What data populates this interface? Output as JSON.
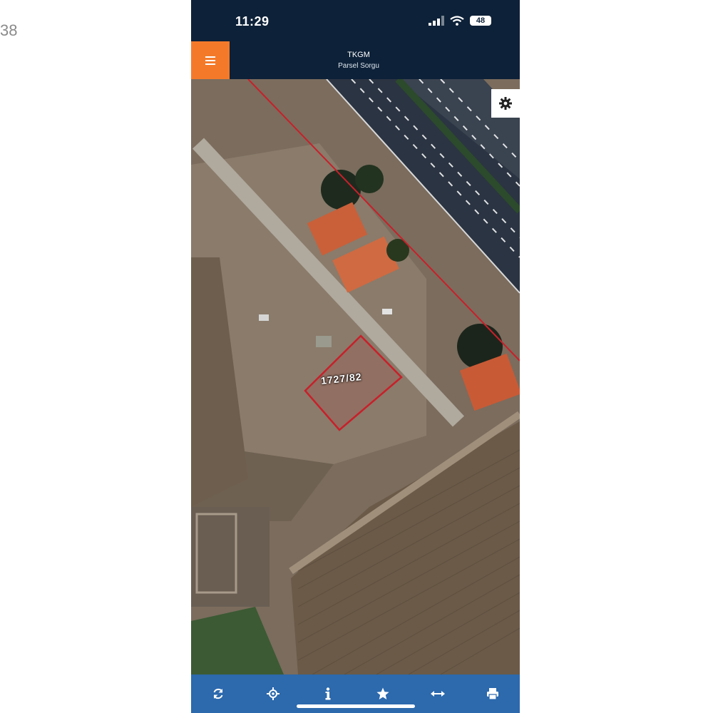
{
  "edge": {
    "left_text": "38"
  },
  "status_bar": {
    "time": "11:29",
    "battery": "48"
  },
  "header": {
    "title": "TKGM",
    "subtitle": "Parsel Sorgu"
  },
  "map": {
    "parcel_label": "1727/82",
    "icons": [
      "gear-icon"
    ]
  },
  "toolbar": {
    "items": [
      {
        "icon": "refresh-icon"
      },
      {
        "icon": "locate-icon"
      },
      {
        "icon": "info-icon"
      },
      {
        "icon": "star-icon"
      },
      {
        "icon": "measure-icon"
      },
      {
        "icon": "print-icon"
      }
    ]
  },
  "colors": {
    "header_bg": "#0d2138",
    "menu_accent": "#f47a2a",
    "toolbar_bg": "#2c69ad",
    "parcel_outline": "#c8202a"
  }
}
